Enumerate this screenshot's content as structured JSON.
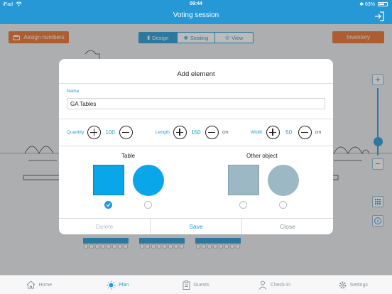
{
  "status_bar": {
    "carrier": "iPad",
    "time": "09:44",
    "battery": "63%"
  },
  "nav": {
    "title": "Voting session"
  },
  "toolbar": {
    "assign_label": "Assign numbers",
    "inventory_label": "Inventory",
    "view_modes": [
      {
        "label": "Design",
        "active": true
      },
      {
        "label": "Seating",
        "active": false
      },
      {
        "label": "View",
        "active": false
      }
    ]
  },
  "zoom": {
    "plus": "+",
    "minus": "−",
    "level": 0.3
  },
  "modal": {
    "title": "Add element",
    "name_label": "Name",
    "name_value": "GA Tables",
    "quantity": {
      "label": "Quantity",
      "value": "100"
    },
    "length": {
      "label": "Length",
      "value": "150",
      "unit": "cm"
    },
    "width": {
      "label": "Width",
      "value": "50",
      "unit": "cm"
    },
    "table_heading": "Table",
    "other_heading": "Other object",
    "options": [
      {
        "group": "table",
        "shape": "square",
        "selected": true
      },
      {
        "group": "table",
        "shape": "circle",
        "selected": false
      },
      {
        "group": "other",
        "shape": "square",
        "selected": false
      },
      {
        "group": "other",
        "shape": "circle",
        "selected": false
      }
    ],
    "delete_label": "Delete",
    "save_label": "Save",
    "close_label": "Close"
  },
  "tabs": [
    {
      "label": "Home",
      "icon": "home-icon",
      "active": false
    },
    {
      "label": "Plan",
      "icon": "sun-icon",
      "active": true
    },
    {
      "label": "Guests",
      "icon": "clipboard-icon",
      "active": false
    },
    {
      "label": "Check-In",
      "icon": "person-icon",
      "active": false
    },
    {
      "label": "Settings",
      "icon": "gear-icon",
      "active": false
    }
  ],
  "colors": {
    "primary": "#2598d5",
    "accent_orange": "#e8702a",
    "table_shape": "#0aa6ea",
    "other_shape": "#9bb8c4",
    "delete_disabled": "#b8bec3"
  }
}
